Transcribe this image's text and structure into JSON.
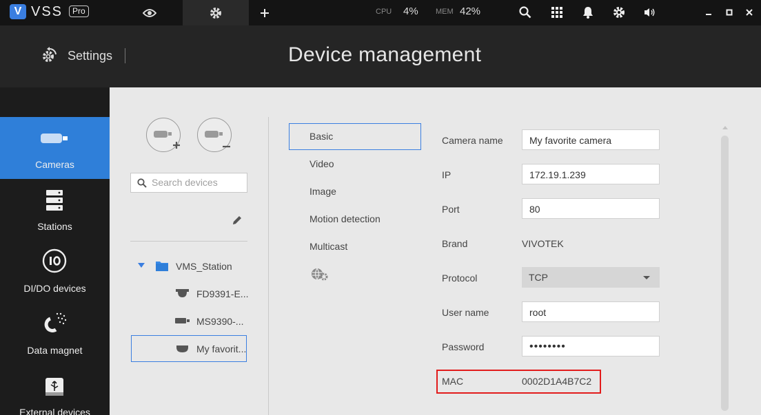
{
  "app": {
    "logo_letter": "V",
    "name": "VSS",
    "edition": "Pro"
  },
  "topbar": {
    "tabs": [
      {
        "icon": "eye-icon",
        "active": false
      },
      {
        "icon": "gear-icon",
        "active": true
      },
      {
        "icon": "plus-icon",
        "active": false
      }
    ],
    "cpu_label": "CPU",
    "cpu_value": "4%",
    "mem_label": "MEM",
    "mem_value": "42%",
    "icons": [
      "search-icon",
      "grid-icon",
      "bell-icon",
      "gear-icon",
      "volume-icon",
      "minimize-icon",
      "maximize-icon",
      "close-icon"
    ]
  },
  "header": {
    "settings_label": "Settings",
    "title": "Device management"
  },
  "sidebar": {
    "items": [
      {
        "label": "Cameras",
        "icon": "camera-icon",
        "active": true
      },
      {
        "label": "Stations",
        "icon": "server-icon",
        "active": false
      },
      {
        "label": "DI/DO devices",
        "icon": "io-icon",
        "active": false
      },
      {
        "label": "Data magnet",
        "icon": "magnet-icon",
        "active": false
      },
      {
        "label": "External devices",
        "icon": "usb-icon",
        "active": false
      }
    ]
  },
  "devices": {
    "search_placeholder": "Search devices",
    "station": "VMS_Station",
    "list": [
      {
        "label": "FD9391-E...",
        "icon": "dome-camera-icon"
      },
      {
        "label": "MS9390-...",
        "icon": "bullet-camera-icon"
      },
      {
        "label": "My favorit...",
        "icon": "fisheye-camera-icon",
        "selected": true
      }
    ]
  },
  "subtabs": [
    {
      "label": "Basic",
      "active": true
    },
    {
      "label": "Video"
    },
    {
      "label": "Image"
    },
    {
      "label": "Motion detection"
    },
    {
      "label": "Multicast"
    }
  ],
  "form": {
    "camera_name_label": "Camera name",
    "camera_name": "My favorite camera",
    "ip_label": "IP",
    "ip": "172.19.1.239",
    "port_label": "Port",
    "port": "80",
    "brand_label": "Brand",
    "brand": "VIVOTEK",
    "protocol_label": "Protocol",
    "protocol": "TCP",
    "username_label": "User name",
    "username": "root",
    "password_label": "Password",
    "password": "••••••••",
    "mac_label": "MAC",
    "mac": "0002D1A4B7C2"
  },
  "colors": {
    "accent": "#2f7fd9",
    "highlight": "#e21b1b",
    "topbar": "#141414",
    "header": "#252525",
    "sidebar": "#1c1c1c"
  }
}
